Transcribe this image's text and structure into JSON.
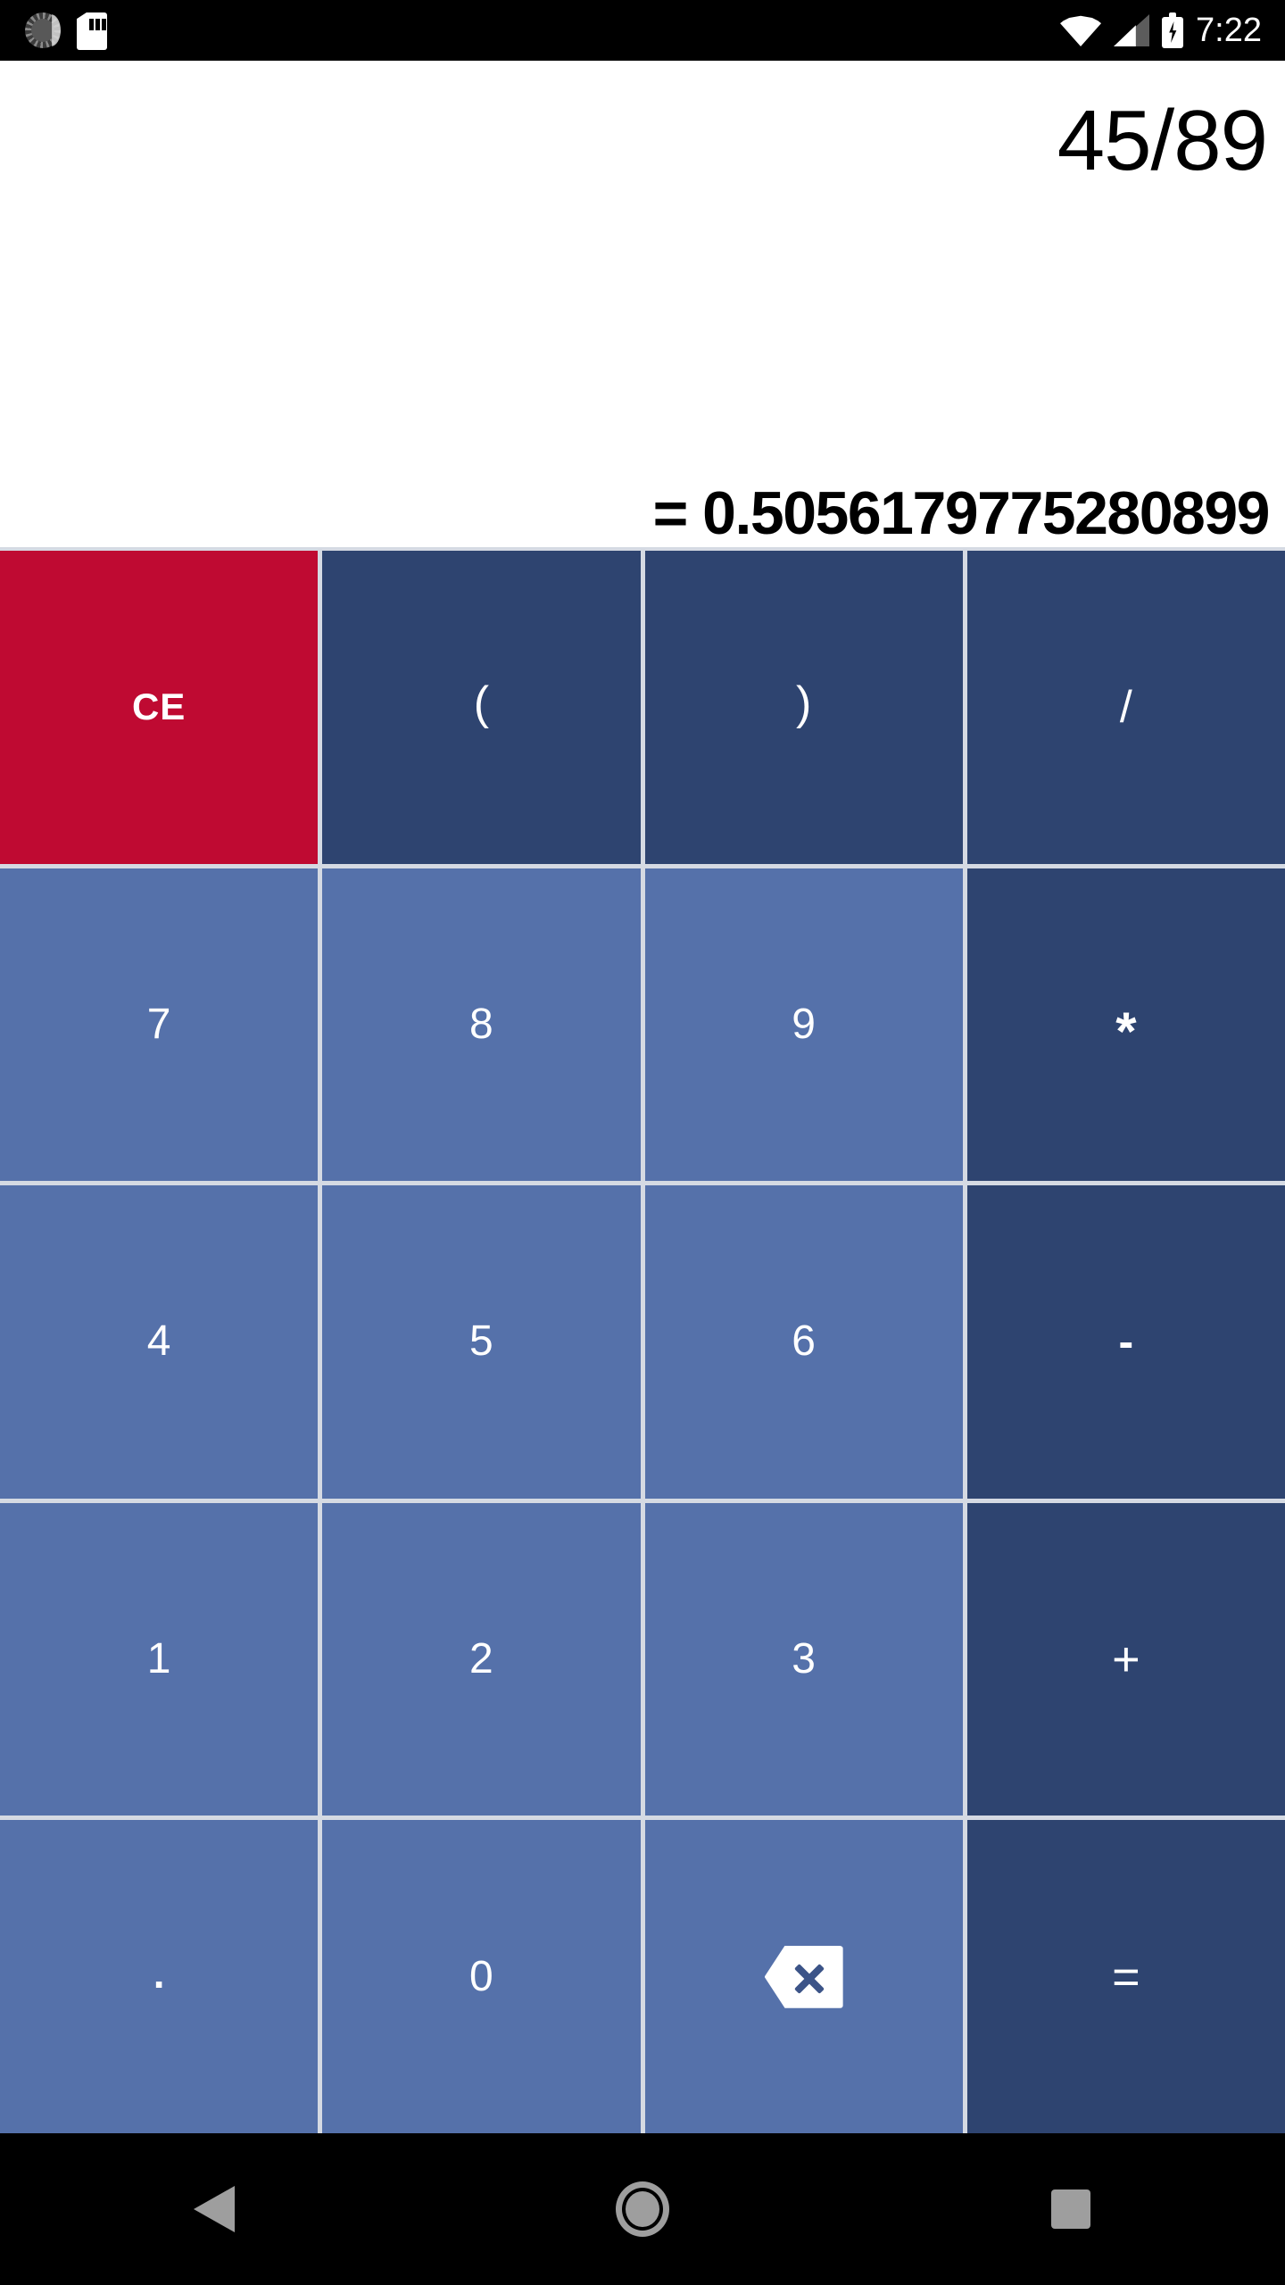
{
  "status_bar": {
    "icons_left": [
      "sync-icon",
      "sd-card-icon"
    ],
    "icons_right": [
      "wifi-icon",
      "cell-signal-icon",
      "battery-charging-icon"
    ],
    "time": "7:22"
  },
  "display": {
    "expression": "45/89",
    "result": "= 0.5056179775280899"
  },
  "keypad": {
    "keys": [
      {
        "label": "CE",
        "name": "clear-entry",
        "kind": "clear"
      },
      {
        "label": "(",
        "name": "open-paren",
        "kind": "paren"
      },
      {
        "label": ")",
        "name": "close-paren",
        "kind": "paren"
      },
      {
        "label": "/",
        "name": "divide",
        "kind": "slash"
      },
      {
        "label": "7",
        "name": "digit-7",
        "kind": "digit"
      },
      {
        "label": "8",
        "name": "digit-8",
        "kind": "digit"
      },
      {
        "label": "9",
        "name": "digit-9",
        "kind": "digit"
      },
      {
        "label": "*",
        "name": "multiply",
        "kind": "star"
      },
      {
        "label": "4",
        "name": "digit-4",
        "kind": "digit"
      },
      {
        "label": "5",
        "name": "digit-5",
        "kind": "digit"
      },
      {
        "label": "6",
        "name": "digit-6",
        "kind": "digit"
      },
      {
        "label": "-",
        "name": "subtract",
        "kind": "minus"
      },
      {
        "label": "1",
        "name": "digit-1",
        "kind": "digit"
      },
      {
        "label": "2",
        "name": "digit-2",
        "kind": "digit"
      },
      {
        "label": "3",
        "name": "digit-3",
        "kind": "digit"
      },
      {
        "label": "+",
        "name": "add",
        "kind": "plus"
      },
      {
        "label": ".",
        "name": "decimal-point",
        "kind": "dot"
      },
      {
        "label": "0",
        "name": "digit-0",
        "kind": "digit"
      },
      {
        "label": "",
        "name": "backspace",
        "kind": "backspace"
      },
      {
        "label": "=",
        "name": "equals",
        "kind": "equals"
      }
    ]
  },
  "nav_bar": {
    "buttons": [
      {
        "name": "back-button",
        "icon": "back-triangle-icon"
      },
      {
        "name": "home-button",
        "icon": "home-circle-icon"
      },
      {
        "name": "recents-button",
        "icon": "recents-square-icon"
      }
    ]
  },
  "colors": {
    "clear_key": "#bf0a32",
    "operator_key": "#2e4470",
    "digit_key": "#5571aa",
    "key_divider": "#d5dae3",
    "status_bar": "#000000",
    "nav_bar": "#000000",
    "display_bg": "#ffffff",
    "display_text": "#000000",
    "nav_icon": "#9e9e9e"
  }
}
